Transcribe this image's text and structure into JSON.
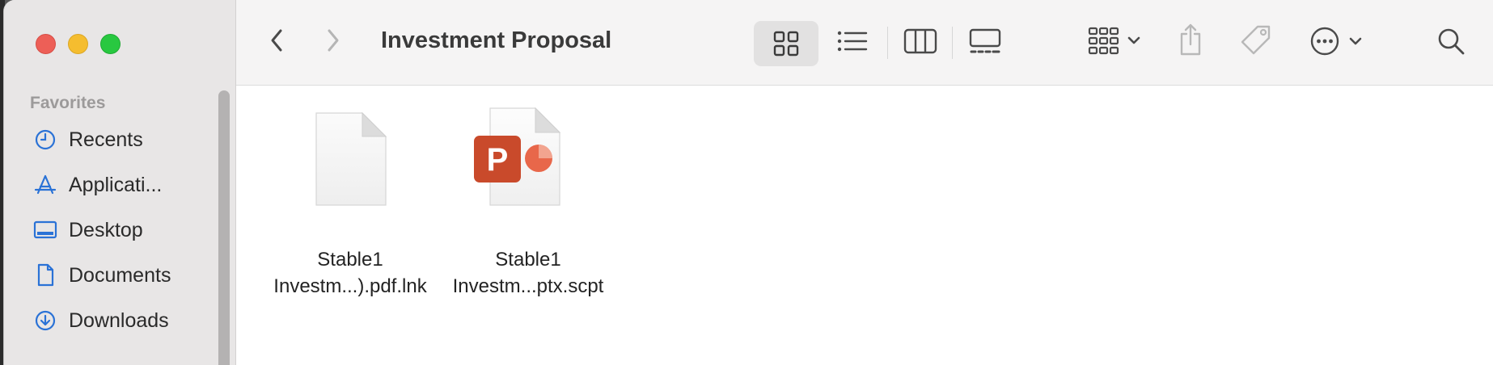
{
  "window": {
    "title": "Investment Proposal"
  },
  "sidebar": {
    "section": "Favorites",
    "items": [
      {
        "label": "Recents",
        "icon": "clock-icon"
      },
      {
        "label": "Applicati...",
        "icon": "applications-icon"
      },
      {
        "label": "Desktop",
        "icon": "desktop-icon"
      },
      {
        "label": "Documents",
        "icon": "document-icon"
      },
      {
        "label": "Downloads",
        "icon": "download-icon"
      }
    ]
  },
  "toolbar": {
    "icons": [
      "back-icon",
      "forward-icon",
      "icon-view-icon",
      "list-view-icon",
      "column-view-icon",
      "gallery-view-icon",
      "group-icon",
      "share-icon",
      "tag-icon",
      "more-icon",
      "search-icon"
    ],
    "active_view": "icon-view"
  },
  "files": [
    {
      "line1": "Stable1",
      "line2": "Investm...).pdf.lnk",
      "icon": "generic-document-icon"
    },
    {
      "line1": "Stable1",
      "line2": "Investm...ptx.scpt",
      "icon": "powerpoint-icon"
    }
  ],
  "colors": {
    "accent": "#2a72d6",
    "powerpoint": "#c94a2b"
  }
}
